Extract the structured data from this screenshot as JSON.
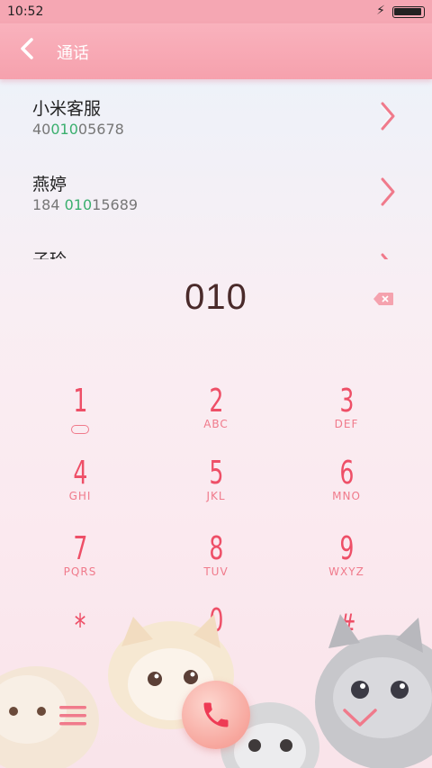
{
  "status_bar": {
    "time": "10:52",
    "bolt_glyph": "⚡",
    "battery_icon": "battery-full-icon"
  },
  "header": {
    "title": "通话",
    "back_icon": "chevron-left-icon"
  },
  "results": [
    {
      "name": "小米客服",
      "num_pre": "40",
      "num_hl": "010",
      "num_post": "05678"
    },
    {
      "name": "燕婷",
      "num_pre": "184 ",
      "num_hl": "010",
      "num_post": "15689"
    },
    {
      "name": "子玲",
      "num_pre": "",
      "num_hl": "",
      "num_post": ""
    }
  ],
  "dialed": "010",
  "keys": [
    {
      "digit": "1",
      "letters": ""
    },
    {
      "digit": "2",
      "letters": "ABC"
    },
    {
      "digit": "3",
      "letters": "DEF"
    },
    {
      "digit": "4",
      "letters": "GHI"
    },
    {
      "digit": "5",
      "letters": "JKL"
    },
    {
      "digit": "6",
      "letters": "MNO"
    },
    {
      "digit": "7",
      "letters": "PQRS"
    },
    {
      "digit": "8",
      "letters": "TUV"
    },
    {
      "digit": "9",
      "letters": "WXYZ"
    },
    {
      "digit": "*",
      "letters": ""
    },
    {
      "digit": "0",
      "letters": "+"
    },
    {
      "digit": "#",
      "letters": ""
    }
  ],
  "colors": {
    "accent": "#f05a6e",
    "header": "#f6a1ad",
    "highlight": "#3aaf6e"
  }
}
